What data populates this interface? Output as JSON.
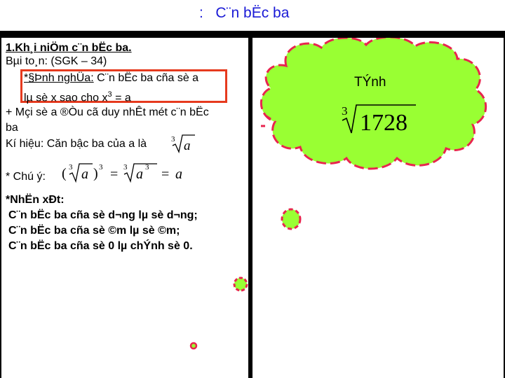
{
  "title": ":   C¨n bËc ba",
  "left": {
    "heading": "1.Kh¸i niÖm c¨n bËc ba.",
    "read": "Bµi to¸n: (SGK – 34)",
    "definition_prefix": "*§Þnh nghÜa:",
    "definition_text": " C¨n bËc ba cña sè a",
    "definition_line2": "lµ sè x sao cho x",
    "definition_exp": "3",
    "definition_end": " = a",
    "note_line1": "+ Mçi sè a ®Òu cã duy nhÊt mét c¨n bËc",
    "note_line2": "ba",
    "symbol_text": "Kí hiệu: Căn bậc ba của a là",
    "symbol_math_index": "3",
    "symbol_math_radicand": "a",
    "attention_label": "* Chú ý:",
    "formula": {
      "index": "3",
      "radicand": "a",
      "power": "3",
      "equals": "=",
      "rhs_index": "3",
      "rhs_radicand_base": "a",
      "rhs_radicand_power": "3",
      "result": "a"
    },
    "observation_heading": "*NhËn xÐt:",
    "obs1": "C¨n bËc ba cña sè d­¬ng lµ sè d­¬ng;",
    "obs2": "C¨n bËc ba cña sè ©m lµ sè ©m;",
    "obs3": "C¨n bËc ba cña sè 0 lµ chÝnh sè 0."
  },
  "right": {
    "calc_label": "TÝnh",
    "calc_index": "3",
    "calc_radicand": "1728"
  },
  "colors": {
    "cloud_fill": "#99ff33",
    "cloud_stroke": "#e8254f",
    "highlight_border": "#e63a1e",
    "title_color": "#1a1ad6"
  }
}
